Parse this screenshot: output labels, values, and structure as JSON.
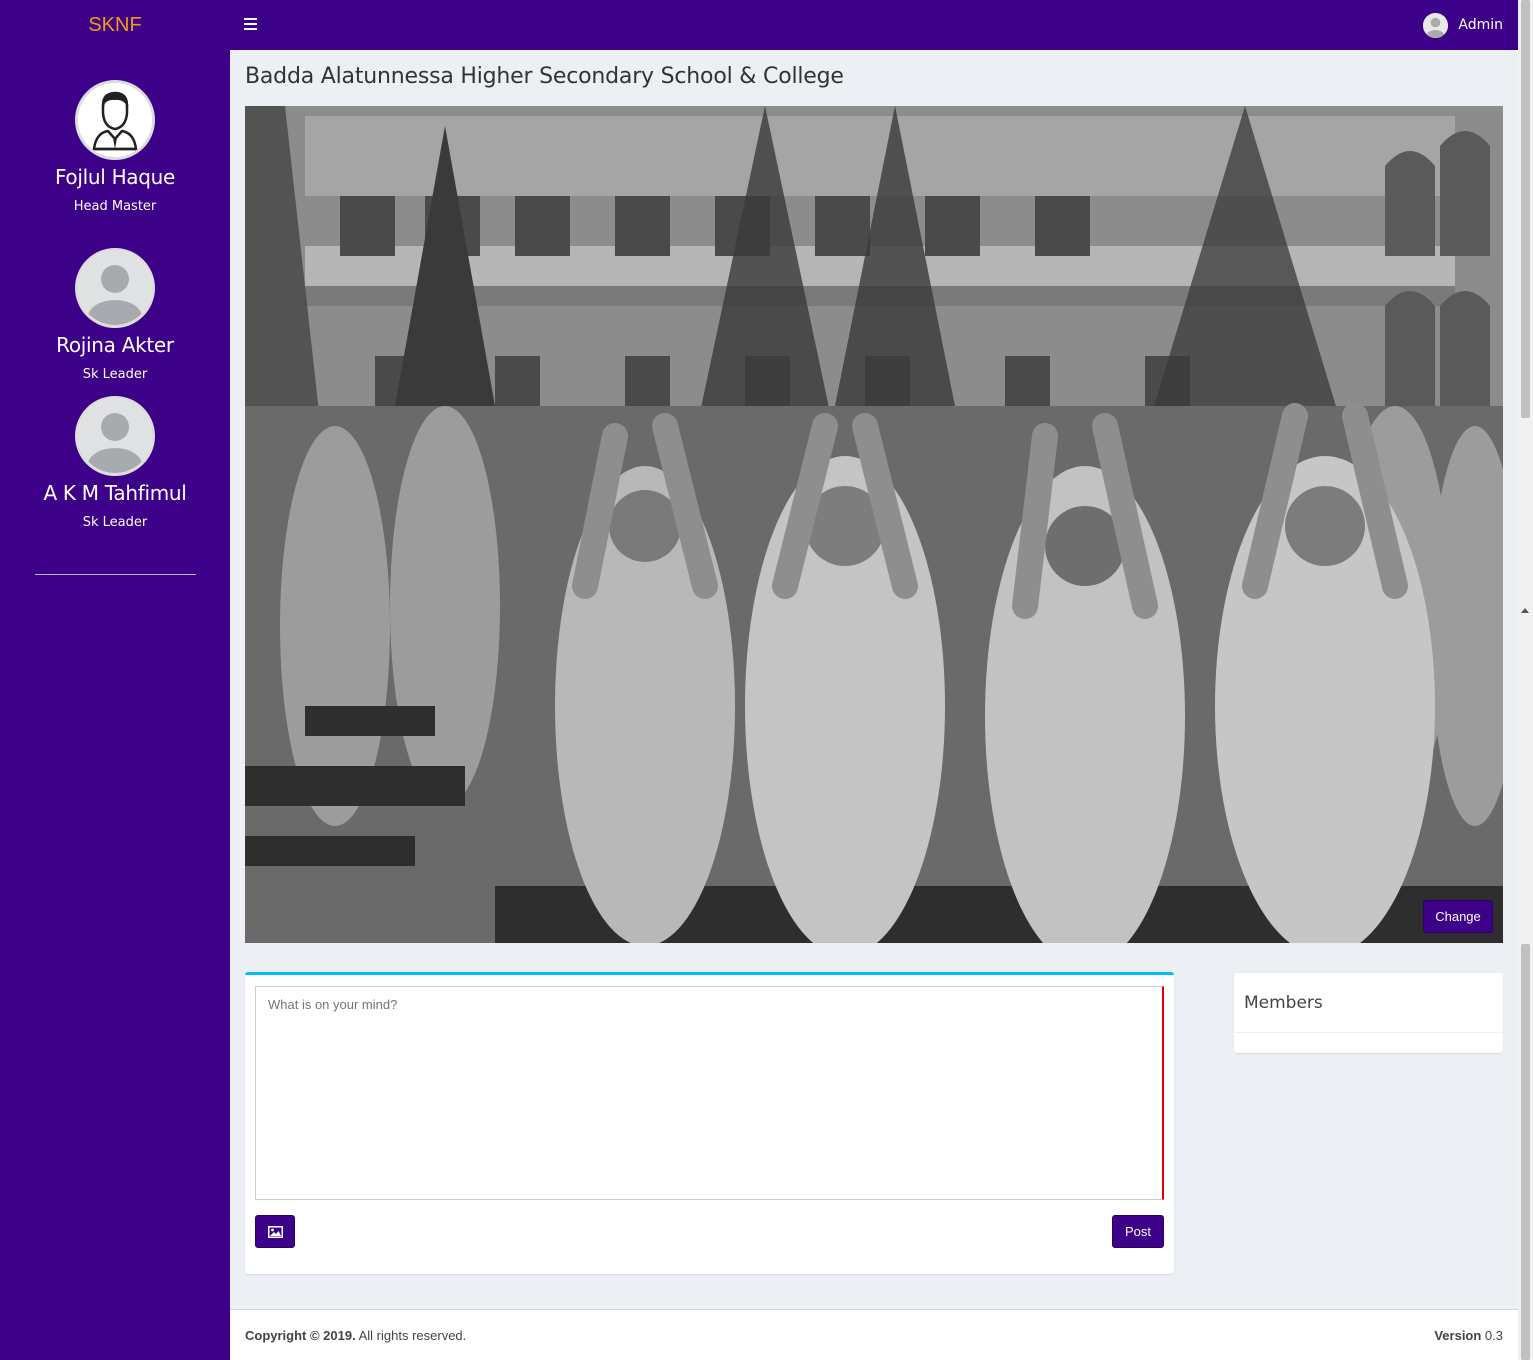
{
  "brand": "SKNF",
  "header": {
    "user_name": "Admin"
  },
  "sidebar": {
    "members": [
      {
        "name": "Fojlul Haque",
        "role": "Head Master"
      },
      {
        "name": "Rojina Akter",
        "role": "Sk Leader"
      },
      {
        "name": "A K M Tahfimul",
        "role": "Sk Leader"
      }
    ]
  },
  "main": {
    "title": "Badda Alatunnessa Higher Secondary School & College",
    "cover_change_label": "Change",
    "post_placeholder": "What is on your mind?",
    "post_button": "Post",
    "members_title": "Members"
  },
  "footer": {
    "copyright_bold": "Copyright © 2019.",
    "copyright_rest": " All rights reserved.",
    "version_label": "Version",
    "version_value": " 0.3"
  },
  "colors": {
    "primary": "#3d0088",
    "brand": "#f39c12",
    "box_accent": "#00c0ef"
  }
}
